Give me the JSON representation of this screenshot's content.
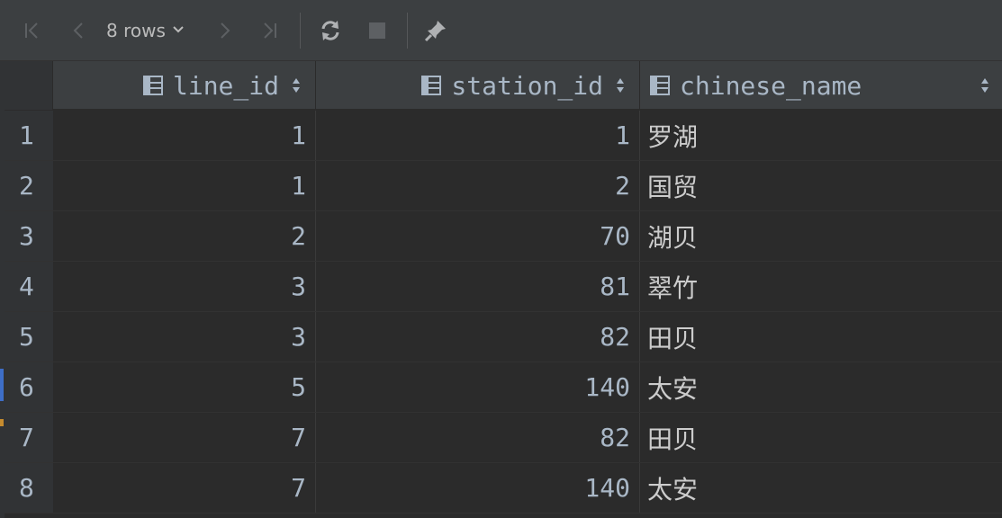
{
  "toolbar": {
    "rows_label": "8 rows",
    "icons": [
      "first-page-icon",
      "prev-page-icon",
      "chevron-down-icon",
      "next-page-icon",
      "last-page-icon",
      "refresh-icon",
      "stop-icon",
      "pin-icon"
    ]
  },
  "columns": [
    {
      "label": "line_id"
    },
    {
      "label": "station_id"
    },
    {
      "label": "chinese_name"
    }
  ],
  "rows": [
    {
      "num": "1",
      "line_id": "1",
      "station_id": "1",
      "chinese_name": "罗湖"
    },
    {
      "num": "2",
      "line_id": "1",
      "station_id": "2",
      "chinese_name": "国贸"
    },
    {
      "num": "3",
      "line_id": "2",
      "station_id": "70",
      "chinese_name": "湖贝"
    },
    {
      "num": "4",
      "line_id": "3",
      "station_id": "81",
      "chinese_name": "翠竹"
    },
    {
      "num": "5",
      "line_id": "3",
      "station_id": "82",
      "chinese_name": "田贝"
    },
    {
      "num": "6",
      "line_id": "5",
      "station_id": "140",
      "chinese_name": "太安"
    },
    {
      "num": "7",
      "line_id": "7",
      "station_id": "82",
      "chinese_name": "田贝"
    },
    {
      "num": "8",
      "line_id": "7",
      "station_id": "140",
      "chinese_name": "太安"
    }
  ],
  "colors": {
    "background": "#2b2b2b",
    "toolbar": "#3c3f41",
    "text": "#a9b7c6",
    "icon_disabled": "#5d6063",
    "icon_enabled": "#afb1b3"
  }
}
